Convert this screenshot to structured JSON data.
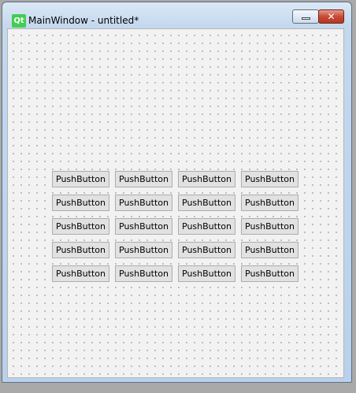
{
  "window": {
    "title": "MainWindow - untitled*",
    "logo_text": "Qt",
    "minimize_icon": "minimize-icon",
    "close_icon": "close-icon"
  },
  "buttons": [
    [
      "PushButton",
      "PushButton",
      "PushButton",
      "PushButton"
    ],
    [
      "PushButton",
      "PushButton",
      "PushButton",
      "PushButton"
    ],
    [
      "PushButton",
      "PushButton",
      "PushButton",
      "PushButton"
    ],
    [
      "PushButton",
      "PushButton",
      "PushButton",
      "PushButton"
    ],
    [
      "PushButton",
      "PushButton",
      "PushButton",
      "PushButton"
    ]
  ]
}
